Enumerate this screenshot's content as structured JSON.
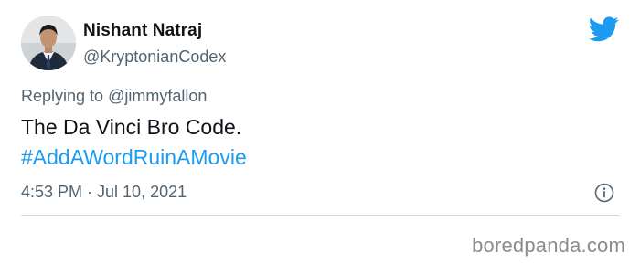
{
  "tweet": {
    "author_name": "Nishant Natraj",
    "author_handle": "@KryptonianCodex",
    "replying_prefix": "Replying to ",
    "replying_to": "@jimmyfallon",
    "text": "The Da Vinci Bro Code.",
    "hashtag": "#AddAWordRuinAMovie",
    "timestamp": "4:53 PM · Jul 10, 2021"
  },
  "icons": {
    "brand": "twitter-bird-icon",
    "info": "info-icon"
  },
  "watermark": "boredpanda.com",
  "colors": {
    "twitter_blue": "#1d9bf0",
    "text_primary": "#0f1419",
    "text_secondary": "#536471",
    "divider": "#cfd9de",
    "watermark": "#8c8c8c"
  }
}
